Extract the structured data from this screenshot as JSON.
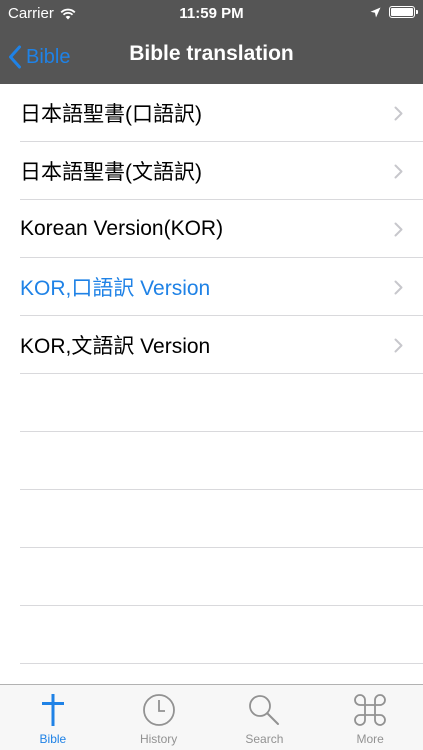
{
  "status_bar": {
    "carrier": "Carrier",
    "time": "11:59 PM"
  },
  "nav_bar": {
    "back_label": "Bible",
    "title": "Bible translation"
  },
  "translations": [
    {
      "label": "日本語聖書(口語訳)",
      "selected": false
    },
    {
      "label": "日本語聖書(文語訳)",
      "selected": false
    },
    {
      "label": "Korean Version(KOR)",
      "selected": false
    },
    {
      "label": "KOR,口語訳 Version",
      "selected": true
    },
    {
      "label": "KOR,文語訳 Version",
      "selected": false
    }
  ],
  "tabs": [
    {
      "label": "Bible",
      "icon": "cross-icon",
      "active": true
    },
    {
      "label": "History",
      "icon": "clock-icon",
      "active": false
    },
    {
      "label": "Search",
      "icon": "magnifier-icon",
      "active": false
    },
    {
      "label": "More",
      "icon": "command-icon",
      "active": false
    }
  ],
  "colors": {
    "accent": "#1f82e6",
    "bar_background": "#555555",
    "tab_inactive": "#929292"
  }
}
